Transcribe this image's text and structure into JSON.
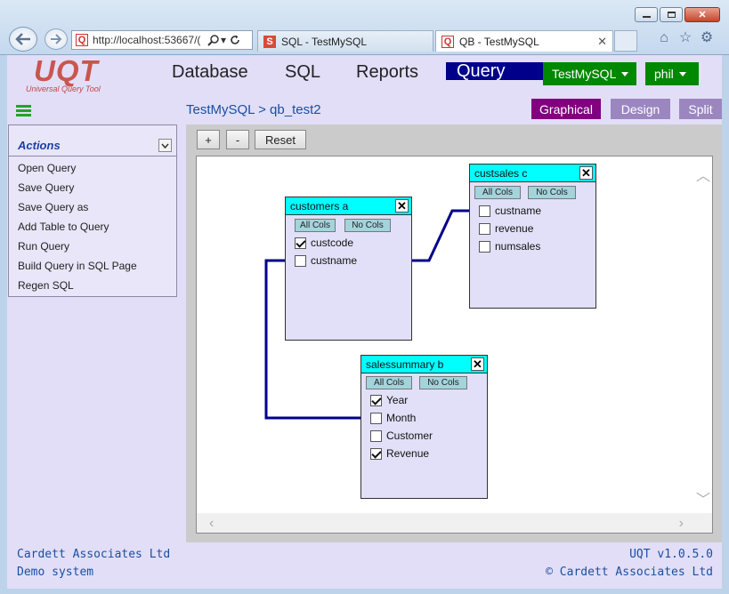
{
  "browser": {
    "url": "http://localhost:53667/(",
    "tabs": [
      {
        "label": "SQL - TestMySQL",
        "favicon": "S"
      },
      {
        "label": "QB - TestMySQL",
        "favicon": "Q",
        "active": true
      }
    ],
    "close_glyph": "✕"
  },
  "app": {
    "logo_text": "UQT",
    "logo_sub": "Universal Query Tool",
    "nav": [
      "Database",
      "SQL",
      "Reports",
      "Query Builder"
    ],
    "active_nav": "Query Builder",
    "db_button": "TestMySQL",
    "user_button": "phil"
  },
  "breadcrumb": "TestMySQL > qb_test2",
  "view_buttons": [
    {
      "label": "Graphical",
      "color": "#800080"
    },
    {
      "label": "Design",
      "color": "#9b86c0"
    },
    {
      "label": "Split",
      "color": "#9b86c0"
    }
  ],
  "actions": {
    "title": "Actions",
    "items": [
      "Open Query",
      "Save Query",
      "Save Query as",
      "Add Table to Query",
      "Run Query",
      "Build Query in SQL Page",
      "Regen SQL"
    ]
  },
  "toolbar": {
    "zoom_in": "+",
    "zoom_out": "-",
    "reset": "Reset"
  },
  "tables": [
    {
      "name": "customers a",
      "all_cols": "All Cols",
      "no_cols": "No Cols",
      "columns": [
        {
          "name": "custcode",
          "checked": true
        },
        {
          "name": "custname",
          "checked": false
        }
      ]
    },
    {
      "name": "custsales c",
      "all_cols": "All Cols",
      "no_cols": "No Cols",
      "columns": [
        {
          "name": "custname",
          "checked": false
        },
        {
          "name": "revenue",
          "checked": false
        },
        {
          "name": "numsales",
          "checked": false
        }
      ]
    },
    {
      "name": "salessummary b",
      "all_cols": "All Cols",
      "no_cols": "No Cols",
      "columns": [
        {
          "name": "Year",
          "checked": true
        },
        {
          "name": "Month",
          "checked": false
        },
        {
          "name": "Customer",
          "checked": false
        },
        {
          "name": "Revenue",
          "checked": true
        }
      ]
    }
  ],
  "footer": {
    "company": "Cardett Associates Ltd",
    "system": "Demo system",
    "version": "UQT v1.0.5.0",
    "copyright": "© Cardett Associates Ltd"
  },
  "colors": {
    "accent_green": "#008800",
    "nav_active": "#00008b",
    "table_header": "#00ffff",
    "join_line": "#00008b"
  }
}
